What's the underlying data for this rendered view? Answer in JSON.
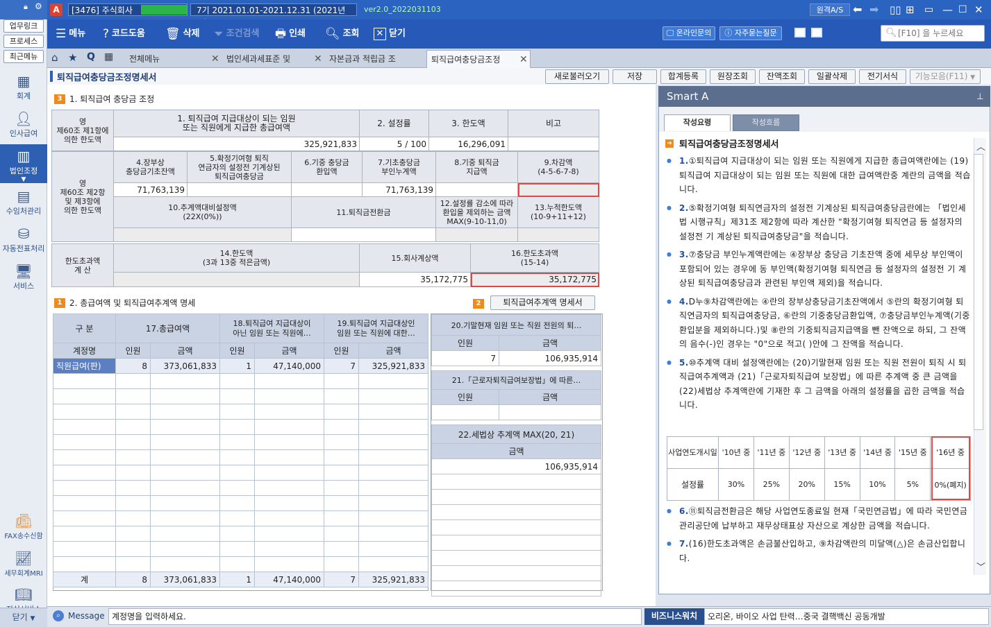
{
  "titlebar": {
    "company": "[3476] 주식회사",
    "period": "7기  2021.01.01-2021.12.31 (2021년도)",
    "version": "ver2.0_2022031103",
    "remote": "원격A/S"
  },
  "sidebar": {
    "quick": [
      "업무링크",
      "프로세스",
      "최근메뉴"
    ],
    "nav": [
      {
        "label": "회계",
        "icon": "calculator-icon"
      },
      {
        "label": "인사급여",
        "icon": "person-icon"
      },
      {
        "label": "법인조정",
        "icon": "building-icon"
      },
      {
        "label": "수임처관리",
        "icon": "client-icon"
      },
      {
        "label": "자동전표처리",
        "icon": "database-icon"
      },
      {
        "label": "서비스",
        "icon": "monitor-icon"
      }
    ],
    "bottom_nav": [
      {
        "label": "FAX송수신함",
        "icon": "fax-icon"
      },
      {
        "label": "세무회계MRI",
        "icon": "chart-icon"
      },
      {
        "label": "지식서비스",
        "icon": "book-icon"
      }
    ],
    "close": "닫기"
  },
  "toolbar": {
    "menu": "메뉴",
    "help": "코드도움",
    "delete": "삭제",
    "condsearch": "조건검색",
    "print": "인쇄",
    "search": "조회",
    "close": "닫기",
    "online": "온라인문의",
    "faq": "자주묻는질문",
    "search_placeholder": "[F10] 을 누르세요"
  },
  "tabs": [
    "전체메뉴",
    "법인세과세표준 및",
    "자본금과 적립금 조",
    "퇴직급여충당금조정"
  ],
  "form": {
    "title": "퇴직급여충당금조정명세서",
    "buttons": [
      "새로불러오기",
      "저장",
      "합계등록",
      "원장조회",
      "잔액조회",
      "일괄삭제",
      "전기서식",
      "기능모음(F11)"
    ]
  },
  "section1": {
    "num": "3",
    "title": "1. 퇴직급여 충당금 조정",
    "rowlabel1": "영\n제60조 제1항에\n의한 한도액",
    "h1": "1. 퇴직급여 지급대상이 되는 임원\n또는 직원에게 지급한 총급여액",
    "h2": "2. 설정률",
    "h3": "3. 한도액",
    "h4": "비고",
    "v1": "325,921,833",
    "v2": "5 / 100",
    "v3": "16,296,091",
    "v4": "",
    "rowlabel2": "영\n제60조 제2항\n및 제3항에\n의한 한도액",
    "h_4": "4.장부상\n충당금기초잔액",
    "h_5": "5.확정기여형 퇴직\n연금자의 설정전 기계상된\n퇴직급여충당금",
    "h_6": "6.기중 충당금\n환입액",
    "h_7": "7.기초충당금\n부인누계액",
    "h_8": "8.기중 퇴직금\n지급액",
    "h_9": "9.차감액\n(4-5-6-7-8)",
    "v_4": "71,763,139",
    "v_7": "71,763,139",
    "h_10": "10.추계액대비설정액\n(22X(0%))",
    "h_11": "11.퇴직금전환금",
    "h_12": "12.설정률 감소에 따라\n환입을 제외하는 금액\nMAX(9-10-11,0)",
    "h_13": "13.누적한도액\n(10-9+11+12)",
    "rowlabel3": "한도초과액\n계      산",
    "h_14": "14.한도액\n(3과 13중 적은금액)",
    "h_15": "15.회사계상액",
    "h_16": "16.한도초과액\n(15-14)",
    "v_15": "35,172,775",
    "v_16": "35,172,775"
  },
  "section2": {
    "num": "1",
    "title": "2. 총급여액 및 퇴직급여추계액 명세",
    "num2": "2",
    "btn": "퇴직급여추계액 명세서",
    "head": {
      "gubun": "구  분",
      "c17": "17.총급여액",
      "c18": "18.퇴직급여 지급대상이\n아닌 임원 또는 직원에…",
      "c19": "19.퇴직급여 지급대상인\n임원 또는 직원에 대한…"
    },
    "sub": {
      "acct": "계정명",
      "cnt": "인원",
      "amt": "금액"
    },
    "row": {
      "name": "직원급여(판)",
      "n17": "8",
      "a17": "373,061,833",
      "n18": "1",
      "a18": "47,140,000",
      "n19": "7",
      "a19": "325,921,833"
    },
    "total": {
      "name": "계",
      "n17": "8",
      "a17": "373,061,833",
      "n18": "1",
      "a18": "47,140,000",
      "n19": "7",
      "a19": "325,921,833"
    }
  },
  "right2": {
    "h20": "20.기말현재 임원 또는 직원 전원의 퇴…",
    "cnt": "인원",
    "amt": "금액",
    "v20n": "7",
    "v20a": "106,935,914",
    "h21": "21.「근로자퇴직급여보장법」에 따른…",
    "h22": "22.세법상 추계액 MAX(20, 21)",
    "v22": "106,935,914"
  },
  "smart": {
    "title": "Smart A",
    "tab1": "작성요령",
    "tab2": "작성흐름",
    "heading": "퇴직급여충당금조정명세서",
    "items": [
      {
        "num": "1.",
        "text": "①퇴직급여 지급대상이 되는 임원 또는 직원에게 지급한 총급여액란에는 (19)퇴직급여 지급대상이 되는 임원 또는 직원에 대한 급여액란중 계란의 금액을 적습니다."
      },
      {
        "num": "2.",
        "text": "⑤확정기여형 퇴직연금자의 설정전 기계상된 퇴직급여충당금란에는 「법인세법 시행규칙」제31조 제2항에 따라 계산한 \"확정기여형 퇴직연금 등 설정자의 설정전 기 계상된 퇴직급여충당금\"을 적습니다."
      },
      {
        "num": "3.",
        "text": "⑦충당금 부인누계액란에는 ④장부상 충당금 기초잔액 중에 세무상 부인액이 포함되어 있는 경우에 동 부인액(확정기여형 퇴직연금 등 설정자의 설정전 기 계상된 퇴직급여충당금과 관련된 부인액 제외)을 적습니다."
      },
      {
        "num": "4.",
        "text": "D누⑨차감액란에는 ④란의 장부상충당금기초잔액에서 ⑤란의 확정기여형 퇴직연금자의 퇴직급여충당금, ⑥란의 기중충당금환입액, ⑦충당금부인누계액(기중환입분을 제외하니다.)및 ⑧란의 기중퇴직금지급액을 뺀 잔액으로 하되, 그 잔액의 음수(-)인 경우는 \"0\"으로 적고( )안에 그 잔액을 적습니다."
      },
      {
        "num": "5.",
        "text": "⑩추계액 대비 설정액란에는 (20)기말현재 임원 또는 직원 전원이 퇴직 시 퇴직급여추계액과 (21)「근로자퇴직급여 보장법」에 따른 추계액 중 큰 금액을 (22)세법상 추계액란에 기재한 후 그 금액을 아래의 설정률을 곱한 금액을 적습니다."
      }
    ],
    "ytable": {
      "h0": "사업연도개시일",
      "years": [
        "'10년 중",
        "'11년 중",
        "'12년 중",
        "'13년 중",
        "'14년 중",
        "'15년 중",
        "'16년 중"
      ],
      "r0": "설정률",
      "rates": [
        "30%",
        "25%",
        "20%",
        "15%",
        "10%",
        "5%",
        "0%(폐지)"
      ]
    },
    "items2": [
      {
        "num": "6.",
        "text": "⑪퇴직금전환금은 해당 사업연도종료일 현재「국민연금법」에 따라 국민연금관리공단에 납부하고 재무상태표상 자산으로 계상한 금액을 적습니다."
      },
      {
        "num": "7.",
        "text": "(16)한도초과액은 손금불산입하고, ⑨차감액란의 미달액(△)은 손금산입합니다."
      }
    ]
  },
  "bottom": {
    "message": "Message",
    "msg_text": "계정명을 입력하세요.",
    "biz": "비즈니스워치",
    "news": "오리온, 바이오 사업 탄력…중국 결핵백신 공동개발"
  }
}
